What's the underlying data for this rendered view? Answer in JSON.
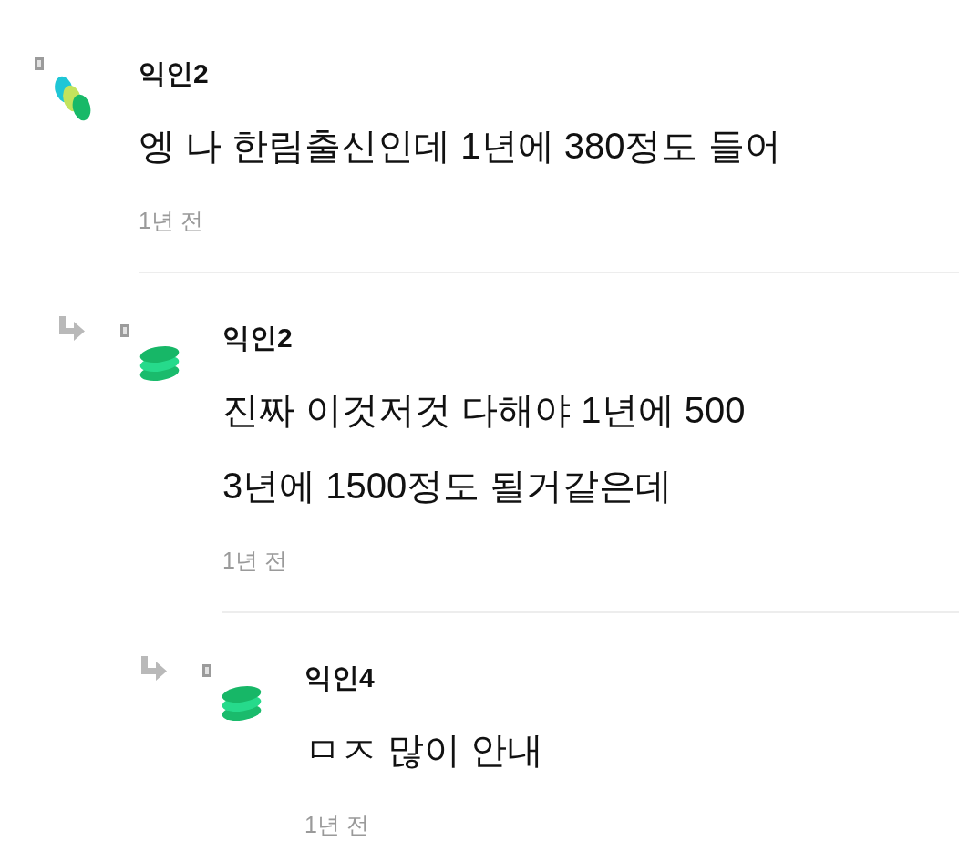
{
  "comments": [
    {
      "kind": "dots",
      "author": "익인2",
      "lines": [
        "엥 나 한림출신인데 1년에 380정도 들어"
      ],
      "time": "1년 전",
      "children": [
        {
          "kind": "stack",
          "author": "익인2",
          "lines": [
            "진짜 이것저것 다해야 1년에 500",
            "3년에 1500정도 될거같은데"
          ],
          "time": "1년 전",
          "children": [
            {
              "kind": "stack",
              "author": "익인4",
              "lines": [
                "ㅁㅈ 많이 안내"
              ],
              "time": "1년 전"
            }
          ]
        }
      ]
    }
  ]
}
